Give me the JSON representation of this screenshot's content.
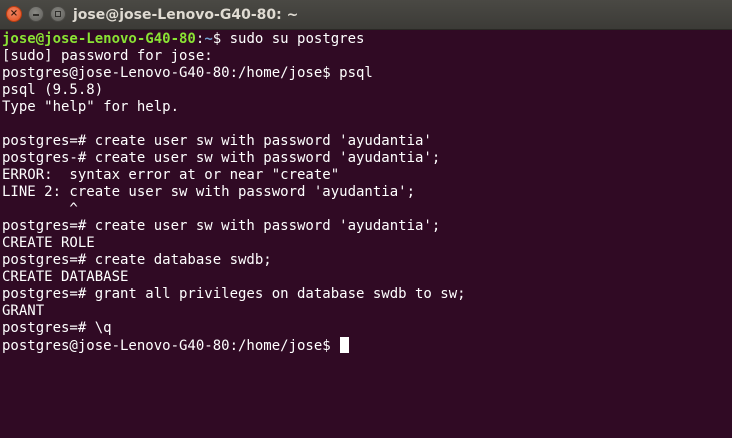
{
  "window": {
    "title": "jose@jose-Lenovo-G40-80: ~",
    "close_glyph": "×"
  },
  "terminal": {
    "prompt": {
      "user_host": "jose@jose-Lenovo-G40-80",
      "separator": ":",
      "path": "~",
      "symbol": "$ ",
      "command": "sudo su postgres"
    },
    "lines": [
      "[sudo] password for jose:",
      "postgres@jose-Lenovo-G40-80:/home/jose$ psql",
      "psql (9.5.8)",
      "Type \"help\" for help.",
      "",
      "postgres=# create user sw with password 'ayudantia'",
      "postgres-# create user sw with password 'ayudantia';",
      "ERROR:  syntax error at or near \"create\"",
      "LINE 2: create user sw with password 'ayudantia';",
      "        ^",
      "postgres=# create user sw with password 'ayudantia';",
      "CREATE ROLE",
      "postgres=# create database swdb;",
      "CREATE DATABASE",
      "postgres=# grant all privileges on database swdb to sw;",
      "GRANT",
      "postgres=# \\q"
    ],
    "current_prompt": "postgres@jose-Lenovo-G40-80:/home/jose$ "
  },
  "colors": {
    "background": "#300a24",
    "titlebar": "#3c3b37",
    "prompt_user": "#8ae234",
    "prompt_path": "#729fcf",
    "text": "#ffffff",
    "close_button": "#df4a16"
  }
}
